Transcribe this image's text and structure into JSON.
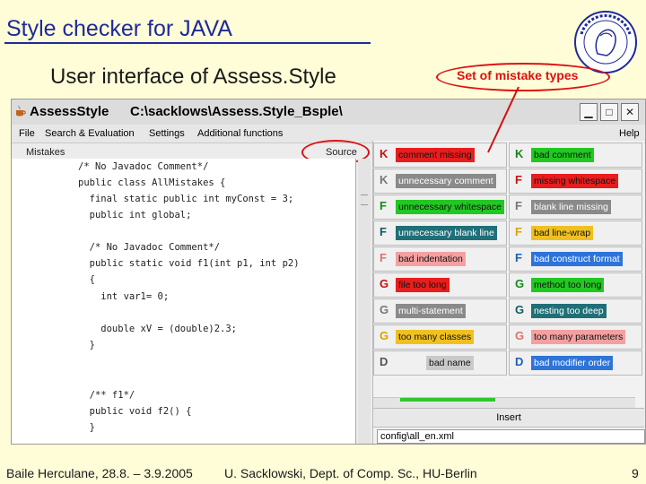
{
  "slide": {
    "title": "Style checker for JAVA",
    "subtitle": "User interface of Assess.Style",
    "callout": "Set of mistake types"
  },
  "window": {
    "app_name": "AssessStyle",
    "path": "C:\\sacklows\\Assess.Style_Bsple\\",
    "minimize_icon": "minimize-icon",
    "maximize_icon": "maximize-icon",
    "close_icon": "close-icon"
  },
  "menu": {
    "items": [
      "File",
      "Search & Evaluation",
      "Settings",
      "Additional functions"
    ],
    "help": "Help"
  },
  "panes": {
    "mistakes_label": "Mistakes",
    "source_label": "Source"
  },
  "code_lines": [
    "/* No Javadoc Comment*/",
    "public class AllMistakes {",
    "  final static public int myConst = 3;",
    "  public int global;",
    "",
    "  /* No Javadoc Comment*/",
    "  public static void f1(int p1, int p2)",
    "  {",
    "    int var1= 0;",
    "",
    "    double xV = (double)2.3;",
    "  }",
    "",
    "  /** f1*/",
    "  public void f2() {",
    "  }"
  ],
  "mistake_types": [
    {
      "letter": "K",
      "label": "comment missing",
      "bg": "#e81d1d",
      "color": "#c81111",
      "fg": "#111"
    },
    {
      "letter": "K",
      "label": "bad comment",
      "bg": "#22c822",
      "color": "#178a17",
      "fg": "#111"
    },
    {
      "letter": "K",
      "label": "unnecessary comment",
      "bg": "#8a8a8a",
      "color": "#777777",
      "fg": "#fff"
    },
    {
      "letter": "F",
      "label": "missing whitespace",
      "bg": "#e81d1d",
      "color": "#c81111",
      "fg": "#111"
    },
    {
      "letter": "F",
      "label": "unnecessary whitespace",
      "bg": "#22c822",
      "color": "#178a17",
      "fg": "#111"
    },
    {
      "letter": "F",
      "label": "blank line missing",
      "bg": "#8a8a8a",
      "color": "#777777",
      "fg": "#fff"
    },
    {
      "letter": "F",
      "label": "unnecessary blank line",
      "bg": "#1f6f78",
      "color": "#155a62",
      "fg": "#fff"
    },
    {
      "letter": "F",
      "label": "bad line-wrap",
      "bg": "#f0c020",
      "color": "#d9a400",
      "fg": "#111"
    },
    {
      "letter": "F",
      "label": "bad indentation",
      "bg": "#f4a0a0",
      "color": "#e07070",
      "fg": "#111"
    },
    {
      "letter": "F",
      "label": "bad construct format",
      "bg": "#2e74d8",
      "color": "#1f5db8",
      "fg": "#fff"
    },
    {
      "letter": "G",
      "label": "file too long",
      "bg": "#e81d1d",
      "color": "#c81111",
      "fg": "#111"
    },
    {
      "letter": "G",
      "label": "method too long",
      "bg": "#22c822",
      "color": "#178a17",
      "fg": "#111"
    },
    {
      "letter": "G",
      "label": "multi-statement",
      "bg": "#8a8a8a",
      "color": "#777777",
      "fg": "#fff"
    },
    {
      "letter": "G",
      "label": "nesting too deep",
      "bg": "#1f6f78",
      "color": "#155a62",
      "fg": "#fff"
    },
    {
      "letter": "G",
      "label": "too many classes",
      "bg": "#f0c020",
      "color": "#d9a400",
      "fg": "#111"
    },
    {
      "letter": "G",
      "label": "too many parameters",
      "bg": "#f4a0a0",
      "color": "#e07070",
      "fg": "#111"
    },
    {
      "letter": "D",
      "label": "bad name",
      "bg": "#c9c9c9",
      "color": "#555555",
      "fg": "#111"
    },
    {
      "letter": "D",
      "label": "bad modifier order",
      "bg": "#2e74d8",
      "color": "#1f5db8",
      "fg": "#fff"
    }
  ],
  "insert_label": "Insert",
  "status_file": "config\\all_en.xml",
  "footer": {
    "left": "Baile Herculane, 28.8. – 3.9.2005",
    "center": "U. Sacklowski, Dept. of Comp. Sc., HU-Berlin",
    "page": "9"
  },
  "colors": {
    "title": "#1f2a9a",
    "highlight": "#d11111",
    "slide_bg": "#fffdd8"
  }
}
